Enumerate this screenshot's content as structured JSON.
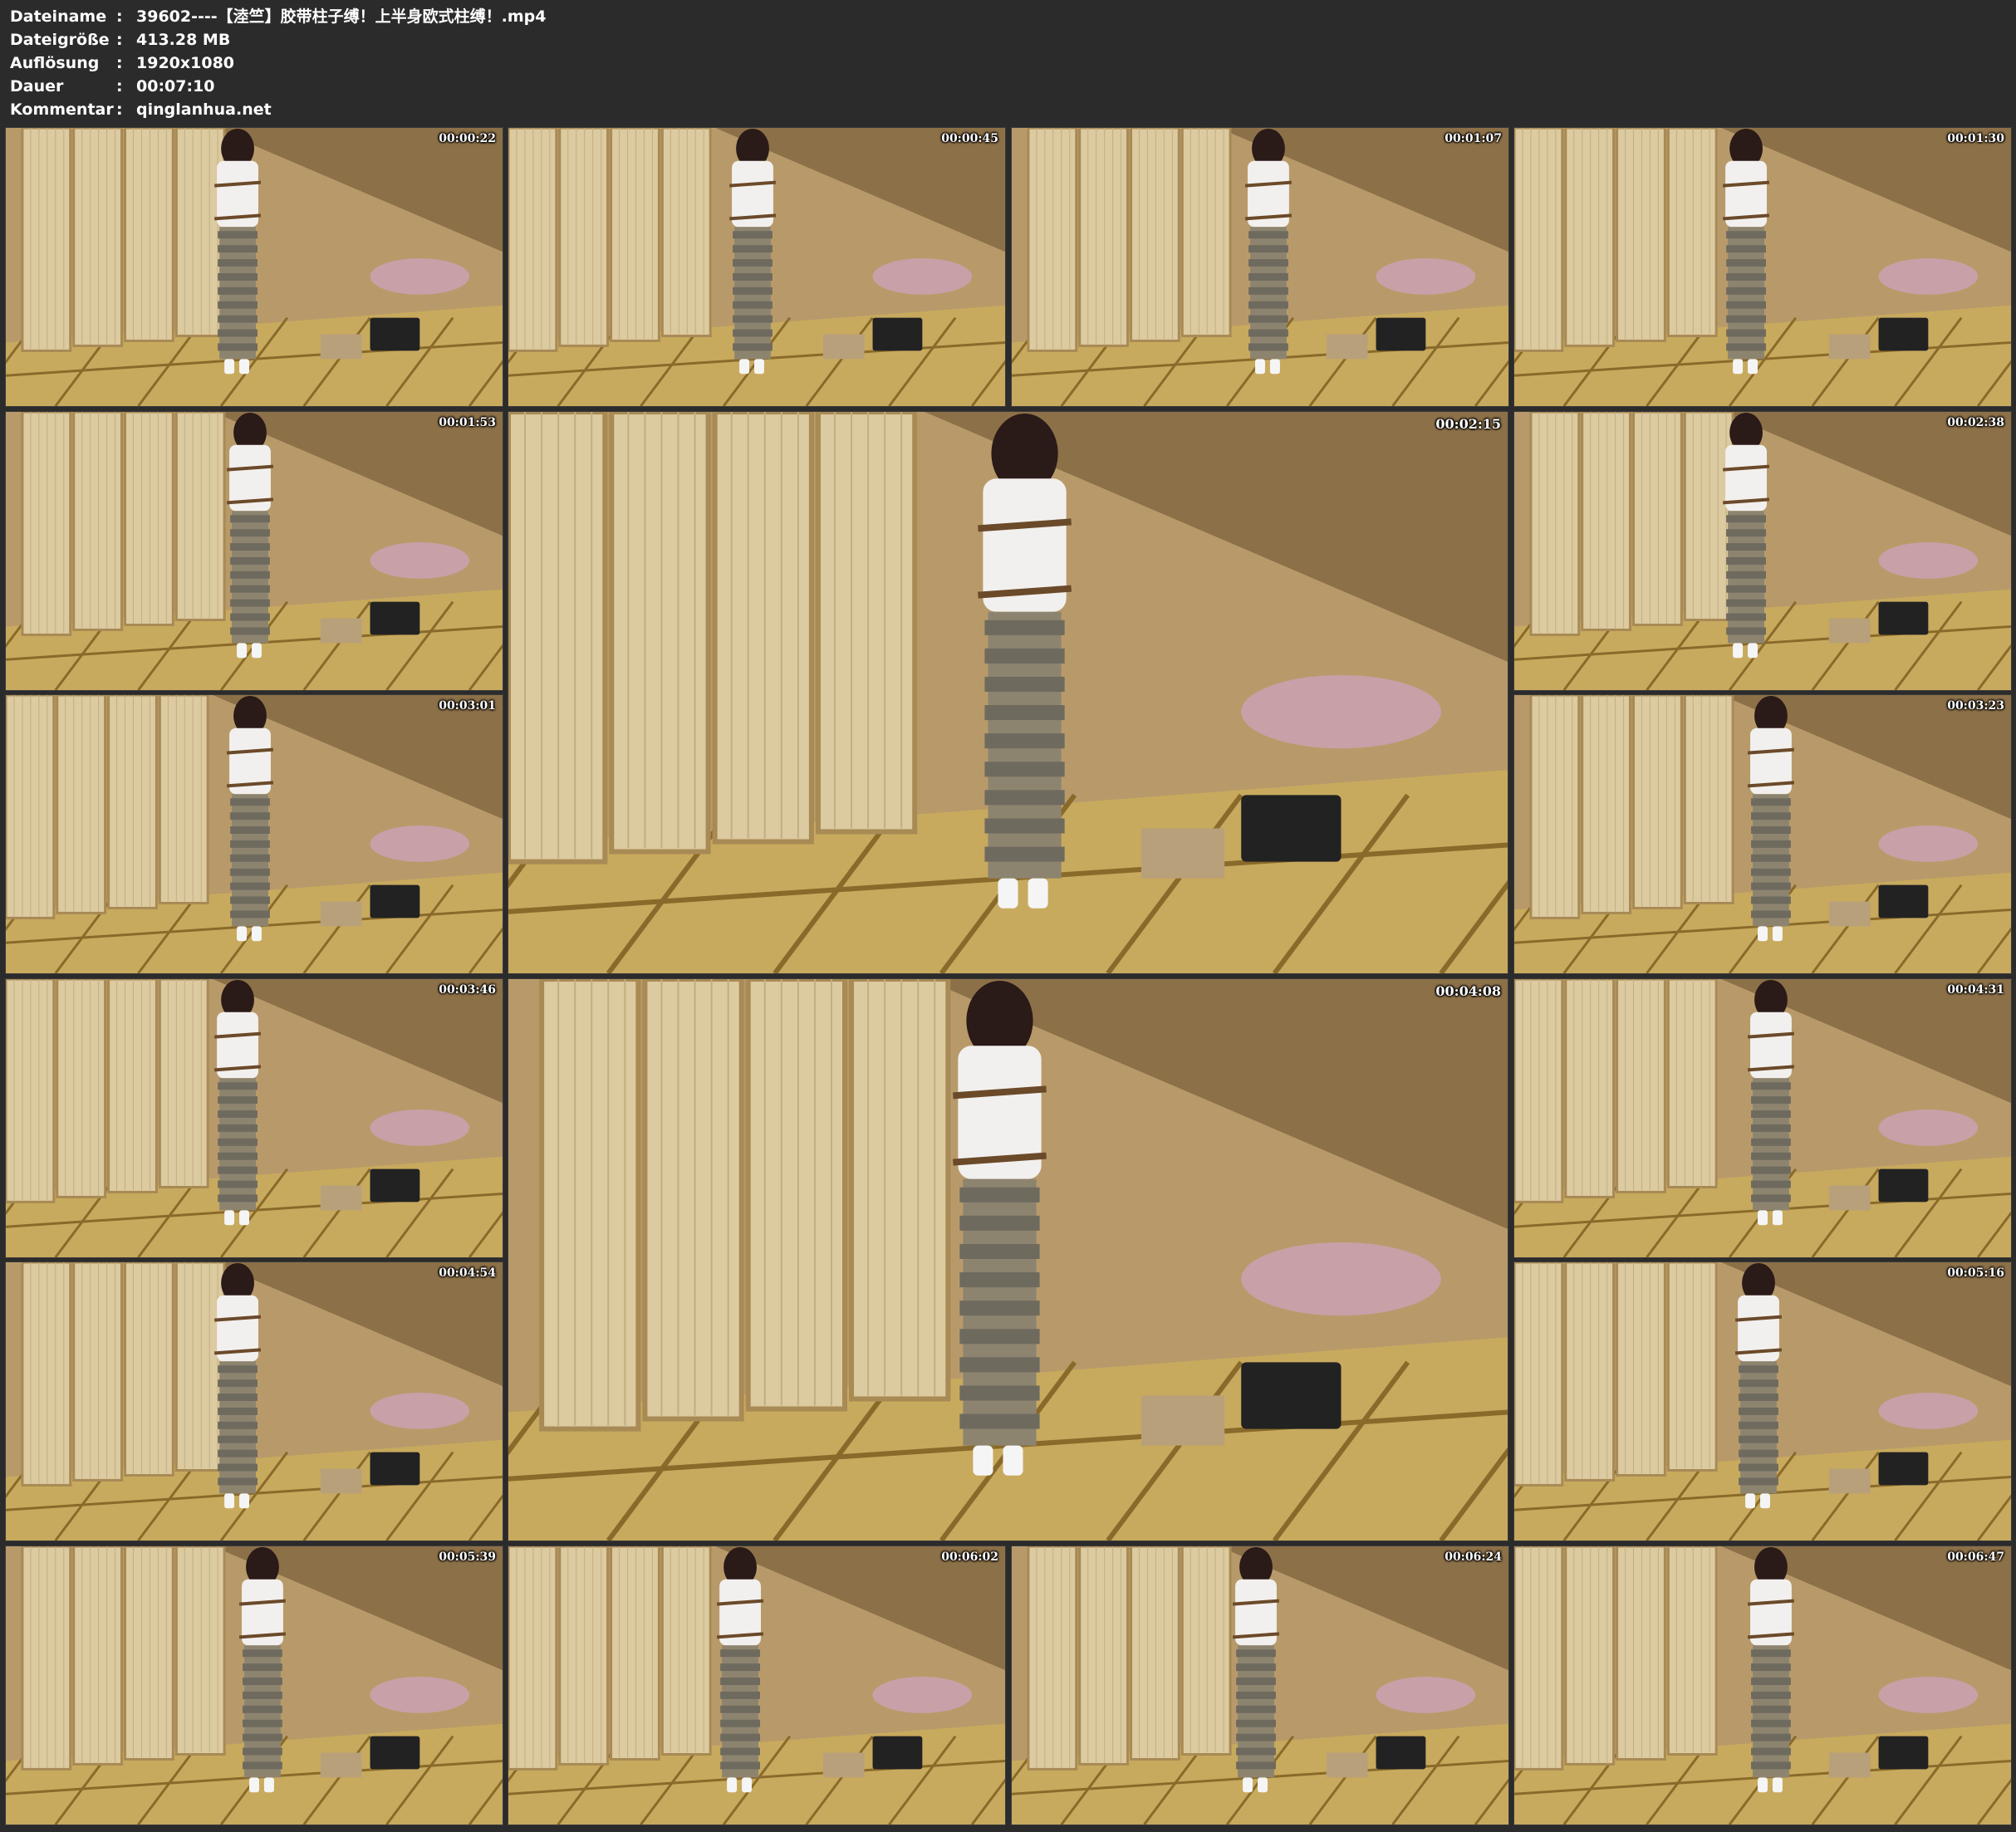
{
  "meta": [
    {
      "key": "Dateiname",
      "value": "39602----【淕竺】胶带柱子缚！上半身欧式柱缚！.mp4"
    },
    {
      "key": "Dateigröße",
      "value": "413.28 MB"
    },
    {
      "key": "Auflösung",
      "value": "1920x1080"
    },
    {
      "key": "Dauer",
      "value": "00:07:10"
    },
    {
      "key": "Kommentar",
      "value": "qinglanhua.net"
    }
  ],
  "meta_separator": ":",
  "thumbnails": [
    {
      "time": "00:00:22"
    },
    {
      "time": "00:00:45"
    },
    {
      "time": "00:01:07"
    },
    {
      "time": "00:01:30"
    },
    {
      "time": "00:01:53"
    },
    {
      "time": "00:02:15"
    },
    {
      "time": "00:02:38"
    },
    {
      "time": "00:03:01"
    },
    {
      "time": "00:03:23"
    },
    {
      "time": "00:03:46"
    },
    {
      "time": "00:04:08"
    },
    {
      "time": "00:04:31"
    },
    {
      "time": "00:04:54"
    },
    {
      "time": "00:05:16"
    },
    {
      "time": "00:05:39"
    },
    {
      "time": "00:06:02"
    },
    {
      "time": "00:06:24"
    },
    {
      "time": "00:06:47"
    }
  ]
}
